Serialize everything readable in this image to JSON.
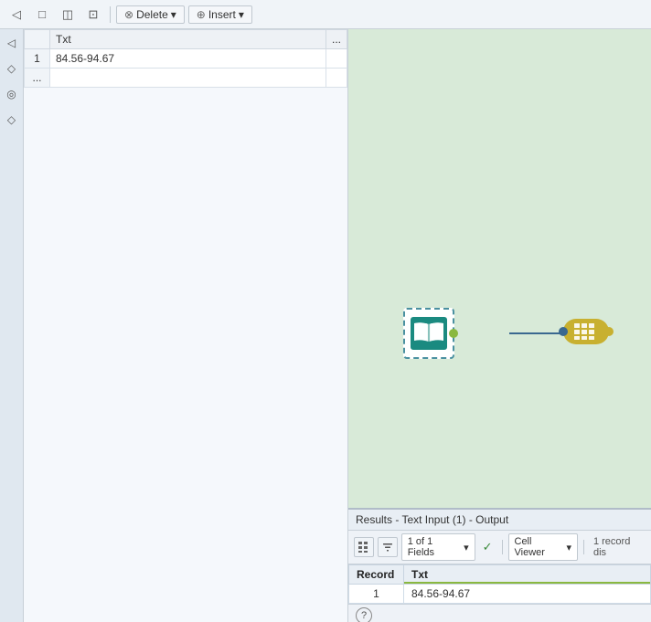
{
  "toolbar": {
    "delete_label": "Delete",
    "insert_label": "Insert",
    "delete_icon": "✕",
    "insert_icon": "+",
    "icons": [
      "◁",
      "□",
      "◫",
      "⊡"
    ]
  },
  "left_panel": {
    "table": {
      "columns": [
        {
          "id": "row_num",
          "label": ""
        },
        {
          "id": "txt",
          "label": "Txt"
        },
        {
          "id": "ellipsis",
          "label": "..."
        }
      ],
      "rows": [
        {
          "row_num": "1",
          "txt": "84.56-94.67"
        },
        {
          "row_num": "...",
          "txt": ""
        }
      ]
    }
  },
  "canvas": {
    "nodes": [
      {
        "id": "text-input",
        "label": "Text Input"
      },
      {
        "id": "browse",
        "label": "Browse"
      }
    ]
  },
  "results_panel": {
    "title": "Results - Text Input (1) - Output",
    "fields_label": "1 of 1 Fields",
    "check_label": "✓",
    "viewer_label": "Cell Viewer",
    "record_info": "1 record dis",
    "table": {
      "columns": [
        {
          "id": "record",
          "label": "Record"
        },
        {
          "id": "txt",
          "label": "Txt"
        }
      ],
      "rows": [
        {
          "record": "1",
          "txt": "84.56-94.67"
        }
      ]
    }
  },
  "sidebar_icons": [
    "◁",
    "◇",
    "◎",
    "◇"
  ]
}
